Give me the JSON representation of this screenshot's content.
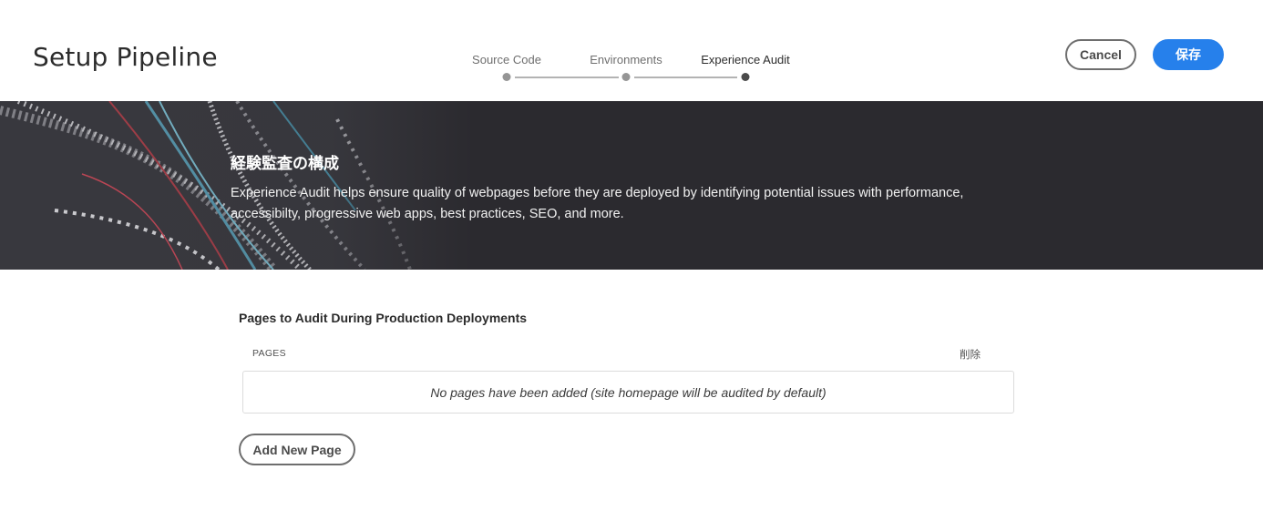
{
  "header": {
    "title": "Setup Pipeline",
    "steps": [
      {
        "label": "Source Code",
        "state": "complete"
      },
      {
        "label": "Environments",
        "state": "complete"
      },
      {
        "label": "Experience Audit",
        "state": "active"
      }
    ],
    "cancel_label": "Cancel",
    "save_label": "保存"
  },
  "hero": {
    "title": "経験監査の構成",
    "description": "Experience Audit helps ensure quality of webpages before they are deployed by identifying potential issues with performance, accessibilty, progressive web apps, best practices, SEO, and more."
  },
  "pages_section": {
    "title": "Pages to Audit During Production Deployments",
    "columns": {
      "pages": "PAGES",
      "delete": "削除"
    },
    "empty_message": "No pages have been added (site homepage will be audited by default)",
    "add_label": "Add New Page"
  },
  "colors": {
    "accent": "#2680eb",
    "hero_bg": "#2b2a2f",
    "step_active": "#4b4b4b",
    "step_complete": "#959595"
  }
}
